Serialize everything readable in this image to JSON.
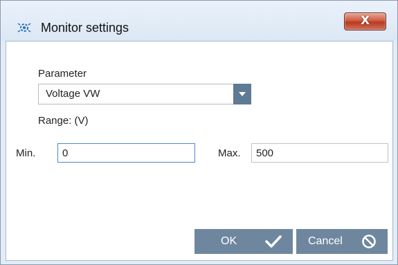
{
  "window": {
    "title": "Monitor settings",
    "close_label": "X",
    "icon": "settings-gear-icon"
  },
  "form": {
    "parameter_label": "Parameter",
    "parameter_value": "Voltage VW",
    "range_label": "Range: (V)",
    "min_label": "Min.",
    "min_value": "0",
    "max_label": "Max.",
    "max_value": "500"
  },
  "buttons": {
    "ok_label": "OK",
    "ok_icon": "checkmark-icon",
    "cancel_label": "Cancel",
    "cancel_icon": "cancel-circle-icon"
  },
  "colors": {
    "button_bg": "#6f879e",
    "dropdown_arrow_bg": "#5e7a94",
    "close_button_red": "#cf5b43",
    "focus_border": "#4f86c6"
  }
}
